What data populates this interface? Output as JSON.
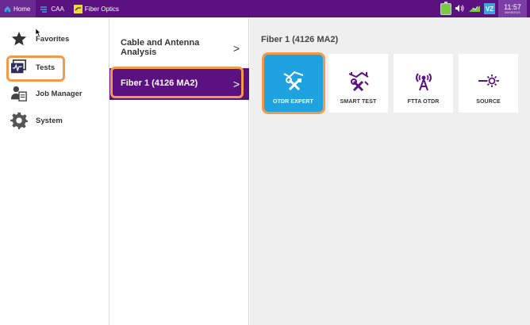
{
  "topbar": {
    "tabs": [
      {
        "label": "Home",
        "icon": "home-icon"
      },
      {
        "label": "CAA",
        "icon": "caa-icon"
      },
      {
        "label": "Fiber Optics",
        "icon": "fiber-optics-icon"
      }
    ],
    "status": {
      "vnc_label": "VZ",
      "time": "11:57",
      "date": "06/08/2021"
    }
  },
  "sidebar": {
    "items": [
      {
        "label": "Favorites",
        "icon": "star-icon"
      },
      {
        "label": "Tests",
        "icon": "tests-icon"
      },
      {
        "label": "Job Manager",
        "icon": "job-manager-icon"
      },
      {
        "label": "System",
        "icon": "gear-icon"
      }
    ]
  },
  "middle": {
    "items": [
      {
        "label": "Cable and Antenna Analysis"
      },
      {
        "label": "Fiber 1 (4126 MA2)"
      }
    ],
    "chevron": ">"
  },
  "main": {
    "title": "Fiber 1 (4126 MA2)",
    "tiles": [
      {
        "label": "OTDR EXPERT",
        "icon": "otdr-expert-icon"
      },
      {
        "label": "SMART TEST",
        "icon": "smart-test-icon"
      },
      {
        "label": "FTTA OTDR",
        "icon": "ftta-otdr-icon"
      },
      {
        "label": "SOURCE",
        "icon": "source-icon"
      }
    ]
  },
  "colors": {
    "brand_purple": "#5b1280",
    "selected_blue": "#1fa3e0",
    "highlight_orange": "#f29a4a"
  }
}
